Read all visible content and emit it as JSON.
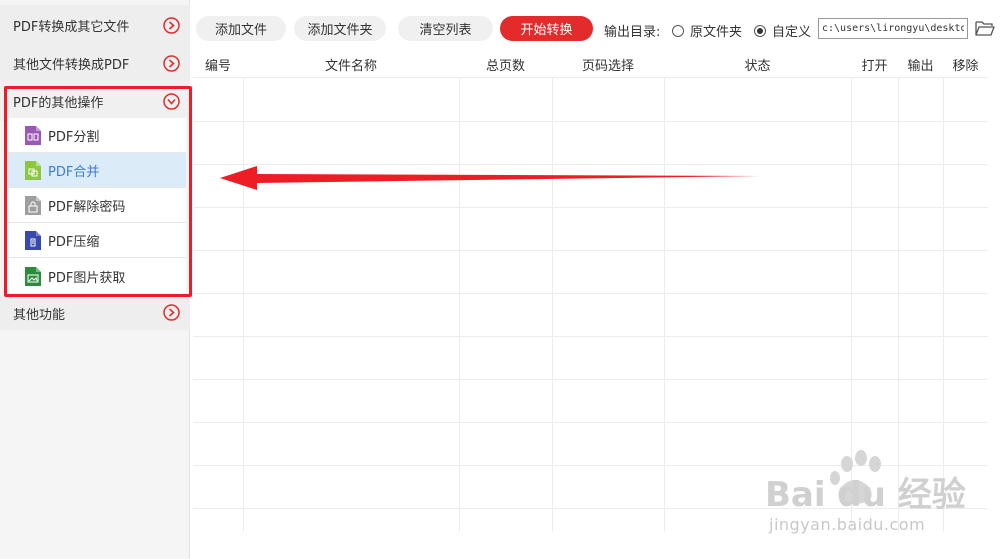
{
  "sidebar": {
    "categories": [
      {
        "label": "PDF转换成其它文件"
      },
      {
        "label": "其他文件转换成PDF"
      },
      {
        "label": "PDF的其他操作"
      },
      {
        "label": "其他功能"
      }
    ],
    "items": [
      {
        "label": "PDF分割",
        "icon": "pdf-split-icon",
        "color": "#9b59b6"
      },
      {
        "label": "PDF合并",
        "icon": "pdf-merge-icon",
        "color": "#8dc63f"
      },
      {
        "label": "PDF解除密码",
        "icon": "pdf-unlock-icon",
        "color": "#9e9e9e"
      },
      {
        "label": "PDF压缩",
        "icon": "pdf-compress-icon",
        "color": "#3949ab"
      },
      {
        "label": "PDF图片获取",
        "icon": "pdf-image-icon",
        "color": "#2e8b3d"
      }
    ],
    "active_item": "PDF合并"
  },
  "toolbar": {
    "add_file": "添加文件",
    "add_folder": "添加文件夹",
    "clear_list": "清空列表",
    "start_convert": "开始转换",
    "output_label": "输出目录:",
    "radio_original": "原文件夹",
    "radio_custom": "自定义",
    "selected_output": "自定义",
    "path_value": "c:\\users\\lirongyu\\desktop"
  },
  "table": {
    "columns": [
      "编号",
      "文件名称",
      "总页数",
      "页码选择",
      "状态",
      "打开",
      "输出",
      "移除"
    ],
    "rows": []
  },
  "colors": {
    "accent_red": "#e32b2b",
    "highlight_box": "#ee1c24",
    "active_item_bg": "#dcebf8",
    "active_item_text": "#3a7fd0"
  },
  "watermark": {
    "brand": "Bai du 经验",
    "url": "jingyan.baidu.com"
  }
}
